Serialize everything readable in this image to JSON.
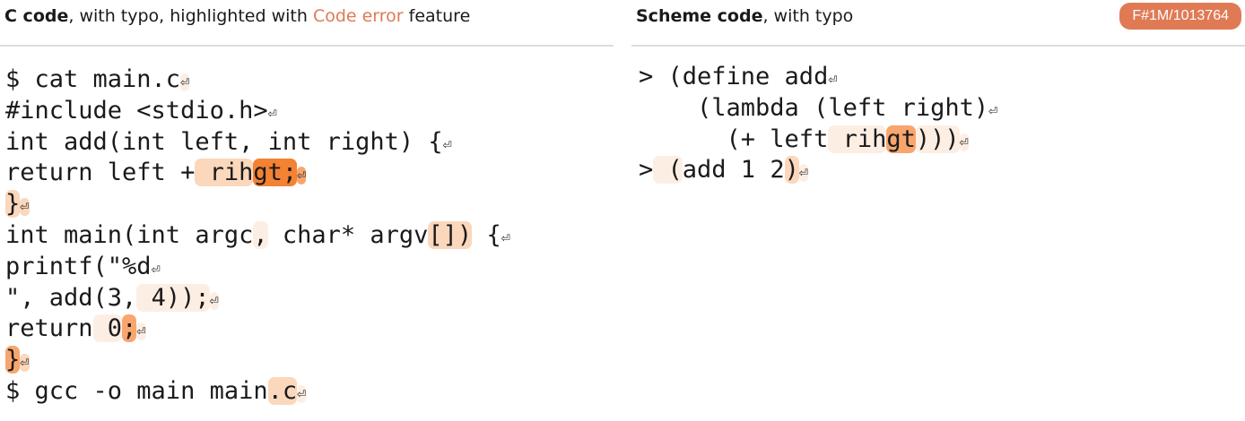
{
  "left_panel": {
    "header": {
      "title_bold": "C code",
      "title_rest_1": ", with typo, highlighted with ",
      "title_accent": "Code error",
      "title_rest_2": " feature"
    },
    "code_lines": [
      [
        {
          "t": "$ cat main.c"
        },
        {
          "t": "⏎",
          "h": 1,
          "nl": 1
        }
      ],
      [
        {
          "t": "#include <stdio.h>"
        },
        {
          "t": "⏎",
          "nl": 1
        }
      ],
      [
        {
          "t": "int add(int left, int right) {"
        },
        {
          "t": "⏎",
          "nl": 1
        }
      ],
      [
        {
          "t": "return left +"
        },
        {
          "t": " rih",
          "h": 2
        },
        {
          "t": "gt;",
          "h": 4
        },
        {
          "t": "⏎",
          "h": 3,
          "nl": 1
        }
      ],
      [
        {
          "t": "}",
          "h": 2
        },
        {
          "t": "⏎",
          "h": 2,
          "nl": 1
        }
      ],
      [
        {
          "t": "int main(int argc"
        },
        {
          "t": ",",
          "h": 1
        },
        {
          "t": " char* argv"
        },
        {
          "t": "[])",
          "h": 2
        },
        {
          "t": " {"
        },
        {
          "t": "⏎",
          "nl": 1
        }
      ],
      [
        {
          "t": "printf(\"%d"
        },
        {
          "t": "⏎",
          "nl": 1
        }
      ],
      [
        {
          "t": "\", add(3,"
        },
        {
          "t": " 4));",
          "h": 1
        },
        {
          "t": "⏎",
          "h": 1,
          "nl": 1
        }
      ],
      [
        {
          "t": "return"
        },
        {
          "t": " 0",
          "h": 1
        },
        {
          "t": ";",
          "h": 3
        },
        {
          "t": "⏎",
          "h": 1,
          "nl": 1
        }
      ],
      [
        {
          "t": "}",
          "h": 3
        },
        {
          "t": "⏎",
          "h": 2,
          "nl": 1
        }
      ],
      [
        {
          "t": "$ gcc -o main main"
        },
        {
          "t": ".c",
          "h": 2
        },
        {
          "t": "⏎",
          "h": 1,
          "nl": 1
        }
      ]
    ]
  },
  "right_panel": {
    "header": {
      "title_bold": "Scheme code",
      "title_rest": ", with typo",
      "badge": "F#1M/1013764"
    },
    "code_lines": [
      [
        {
          "t": "> (define add"
        },
        {
          "t": "⏎",
          "nl": 1
        }
      ],
      [
        {
          "t": "    (lambda (left right)"
        },
        {
          "t": "⏎",
          "nl": 1
        }
      ],
      [
        {
          "t": "      (+ left"
        },
        {
          "t": " rih",
          "h": 1
        },
        {
          "t": "gt",
          "h": 3
        },
        {
          "t": ")))",
          "h": 1
        },
        {
          "t": "⏎",
          "h": 1,
          "nl": 1
        }
      ],
      [
        {
          "t": ">"
        },
        {
          "t": " (",
          "h": 1
        },
        {
          "t": "add 1 2"
        },
        {
          "t": ")",
          "h": 2
        },
        {
          "t": "⏎",
          "h": 1,
          "nl": 1
        }
      ]
    ]
  },
  "colors": {
    "accent": "#e07a55",
    "highlight_levels": [
      "#fdeee4",
      "#fbd7bc",
      "#f8a66e",
      "#f38233"
    ]
  }
}
